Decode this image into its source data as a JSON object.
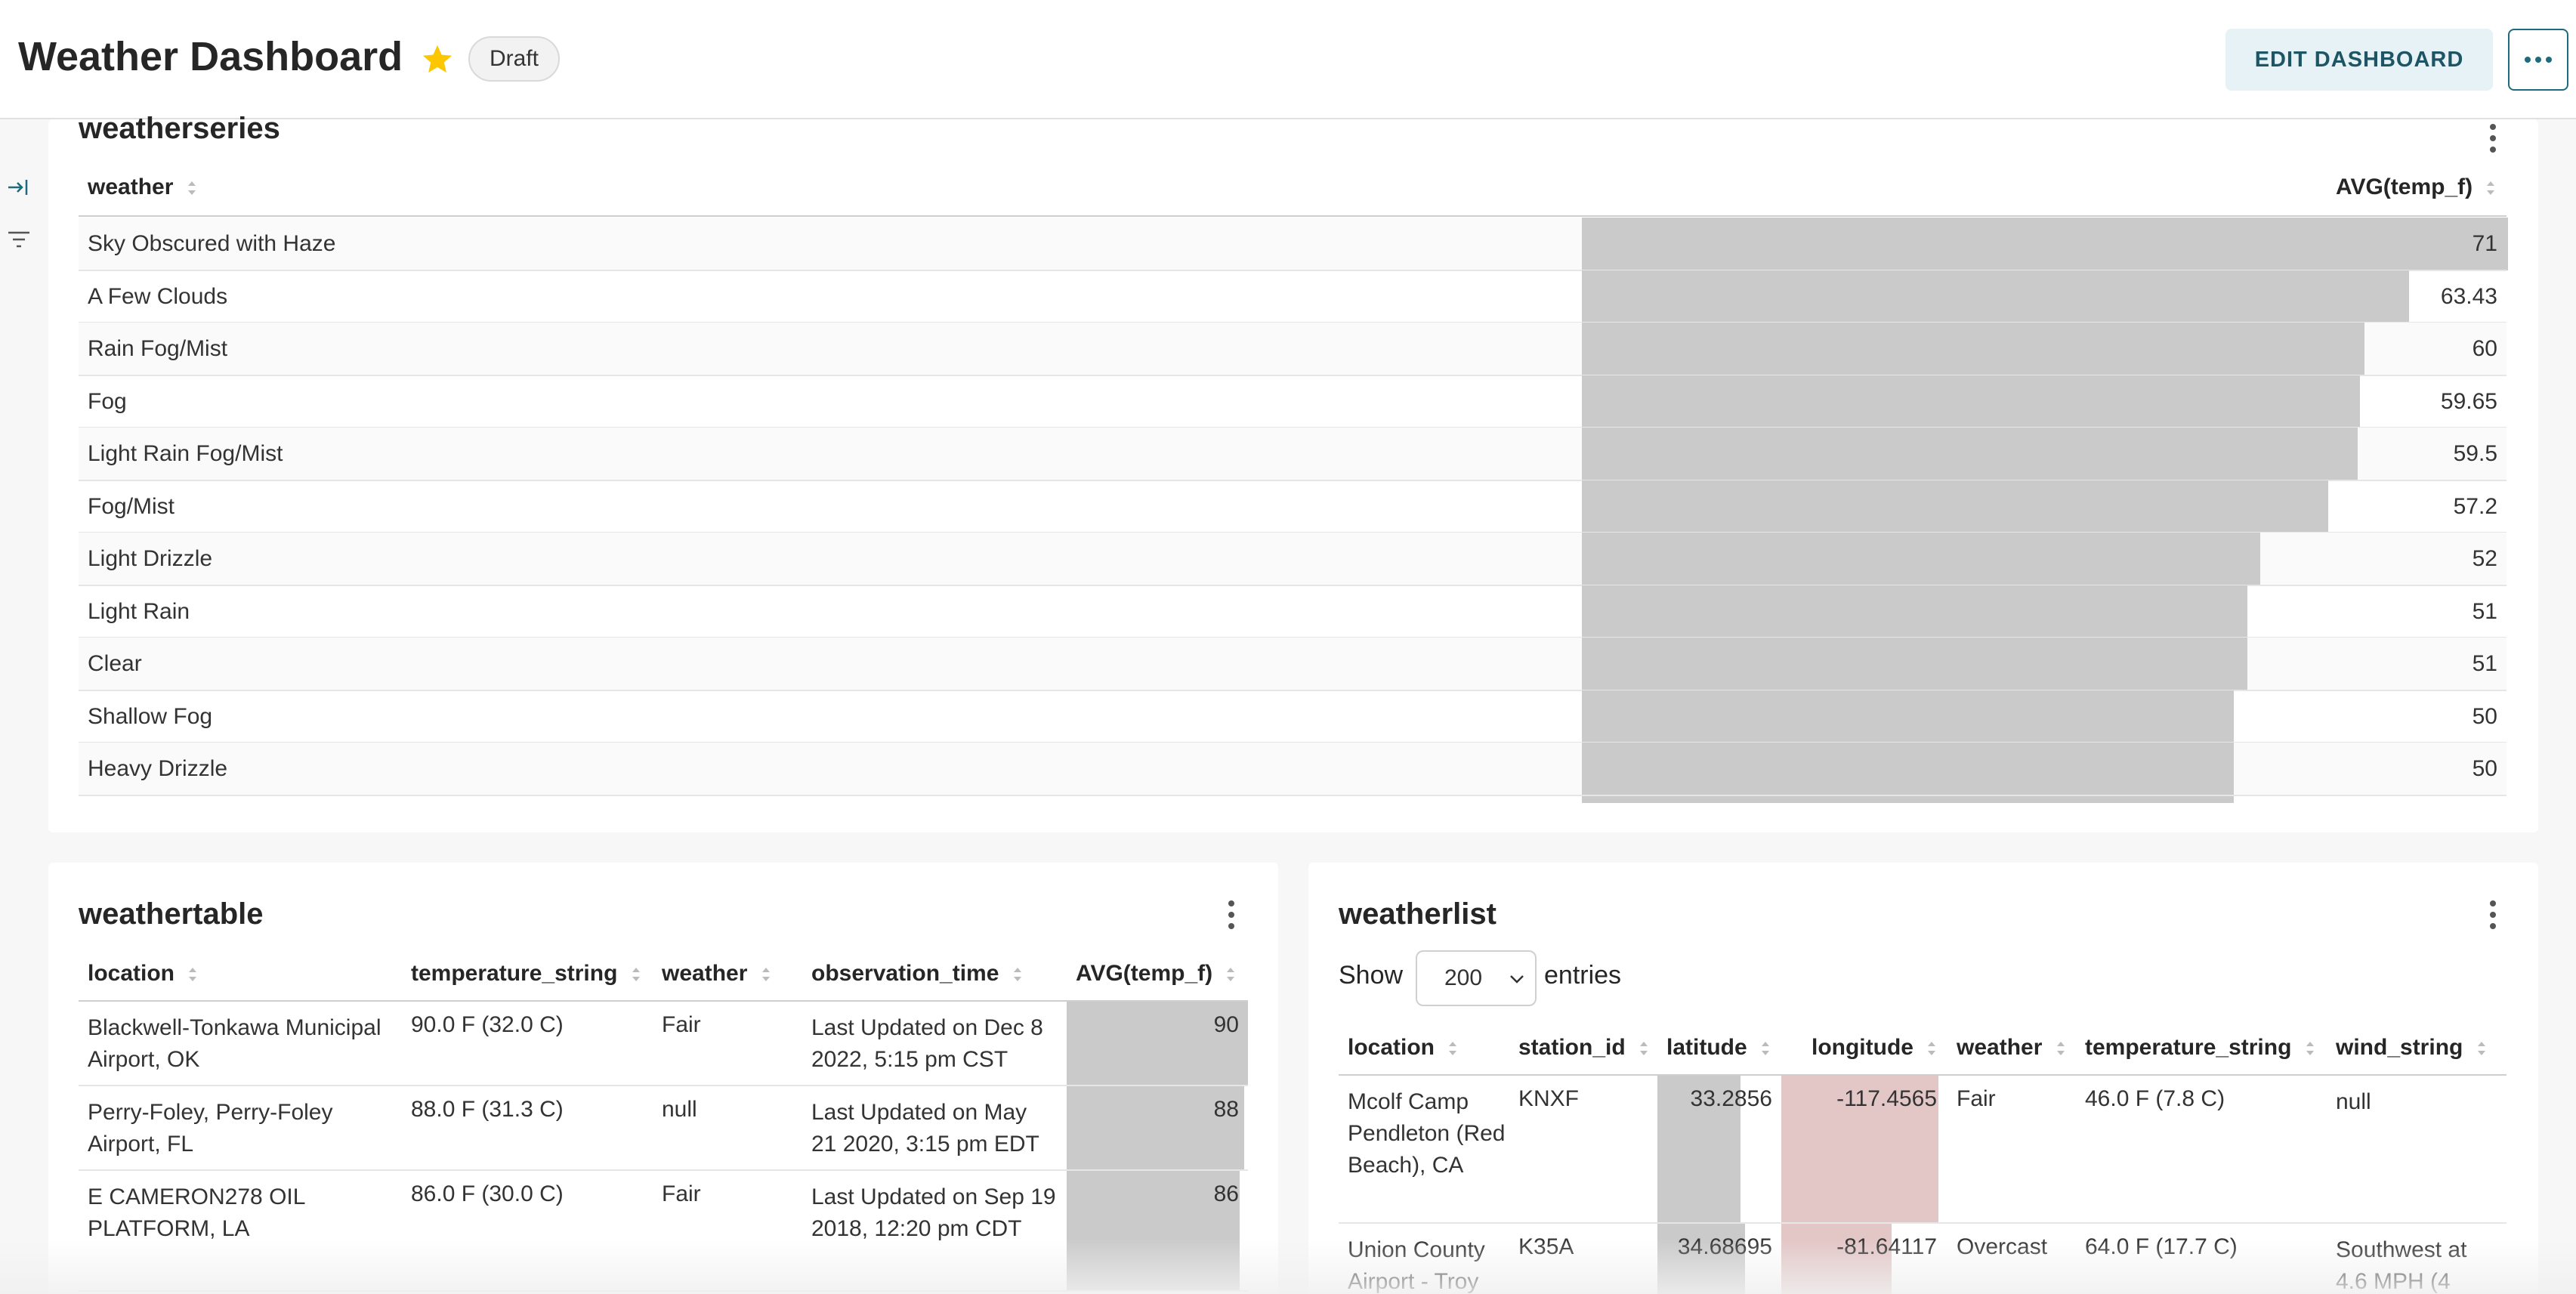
{
  "header": {
    "title": "Weather Dashboard",
    "status_badge": "Draft",
    "edit_button": "EDIT DASHBOARD",
    "more_icon": "ellipsis-icon"
  },
  "colors": {
    "accent": "#1d6b7d",
    "star": "#fcc700",
    "bar": "#cacaca",
    "neg_bar": "#e3c6c6"
  },
  "weatherseries": {
    "title": "weatherseries",
    "columns": [
      "weather",
      "AVG(temp_f)"
    ],
    "rows": [
      {
        "weather": "Sky Obscured with Haze",
        "avg": "71"
      },
      {
        "weather": "A Few Clouds",
        "avg": "63.43"
      },
      {
        "weather": "Rain Fog/Mist",
        "avg": "60"
      },
      {
        "weather": "Fog",
        "avg": "59.65"
      },
      {
        "weather": "Light Rain Fog/Mist",
        "avg": "59.5"
      },
      {
        "weather": "Fog/Mist",
        "avg": "57.2"
      },
      {
        "weather": "Light Drizzle",
        "avg": "52"
      },
      {
        "weather": "Light Rain",
        "avg": "51"
      },
      {
        "weather": "Clear",
        "avg": "51"
      },
      {
        "weather": "Shallow Fog",
        "avg": "50"
      },
      {
        "weather": "Heavy Drizzle",
        "avg": "50"
      }
    ]
  },
  "weathertable": {
    "title": "weathertable",
    "columns": [
      "location",
      "temperature_string",
      "weather",
      "observation_time",
      "AVG(temp_f)"
    ],
    "rows": [
      {
        "location": "Blackwell-Tonkawa Municipal Airport, OK",
        "temperature_string": "90.0 F (32.0 C)",
        "weather": "Fair",
        "observation_time": "Last Updated on Dec 8 2022, 5:15 pm CST",
        "avg": "90"
      },
      {
        "location": "Perry-Foley, Perry-Foley Airport, FL",
        "temperature_string": "88.0 F (31.3 C)",
        "weather": "null",
        "observation_time": "Last Updated on May 21 2020, 3:15 pm EDT",
        "avg": "88"
      },
      {
        "location": "E CAMERON278 OIL PLATFORM, LA",
        "temperature_string": "86.0 F (30.0 C)",
        "weather": "Fair",
        "observation_time": "Last Updated on Sep 19 2018, 12:20 pm CDT",
        "avg": "86"
      }
    ]
  },
  "weatherlist": {
    "title": "weatherlist",
    "show_label": "Show",
    "page_size": "200",
    "entries_label": "entries",
    "columns": [
      "location",
      "station_id",
      "latitude",
      "longitude",
      "weather",
      "temperature_string",
      "wind_string"
    ],
    "rows": [
      {
        "location": "Mcolf Camp Pendleton (Red Beach), CA",
        "station_id": "KNXF",
        "latitude": "33.2856",
        "longitude": "-117.4565",
        "weather": "Fair",
        "temperature_string": "46.0 F (7.8 C)",
        "wind_string": "null"
      },
      {
        "location": "Union County Airport - Troy",
        "station_id": "K35A",
        "latitude": "34.68695",
        "longitude": "-81.64117",
        "weather": "Overcast",
        "temperature_string": "64.0 F (17.7 C)",
        "wind_string": "Southwest at 4.6 MPH (4"
      }
    ]
  }
}
